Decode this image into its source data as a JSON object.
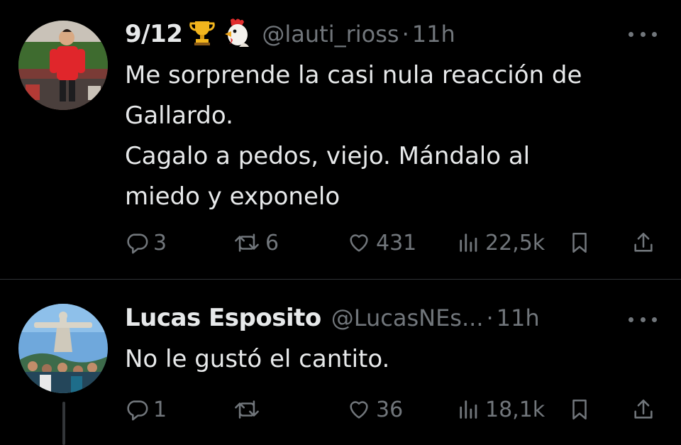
{
  "tweets": [
    {
      "name": "9/12",
      "emojis": [
        "trophy",
        "rooster"
      ],
      "handle": "@lauti_rioss",
      "separator": "·",
      "time": "11h",
      "text_lines": [
        "Me sorprende la casi nula reacción de",
        "Gallardo.",
        "Cagalo a pedos, viejo. Mándalo al",
        "miedo y exponelo"
      ],
      "actions": {
        "replies": "3",
        "retweets": "6",
        "likes": "431",
        "views": "22,5k"
      }
    },
    {
      "name": "Lucas Esposito",
      "handle": "@LucasNEs...",
      "separator": "·",
      "time": "11h",
      "text_lines": [
        "No le gustó el cantito."
      ],
      "actions": {
        "replies": "1",
        "retweets": "",
        "likes": "36",
        "views": "18,1k"
      }
    }
  ],
  "icons": {
    "reply": "reply-icon",
    "retweet": "retweet-icon",
    "like": "like-icon",
    "views": "views-icon",
    "bookmark": "bookmark-icon",
    "share": "share-icon",
    "more": "more-icon"
  },
  "colors": {
    "background": "#000000",
    "text": "#e7e9ea",
    "secondary": "#71767b",
    "divider": "#2f3336"
  }
}
